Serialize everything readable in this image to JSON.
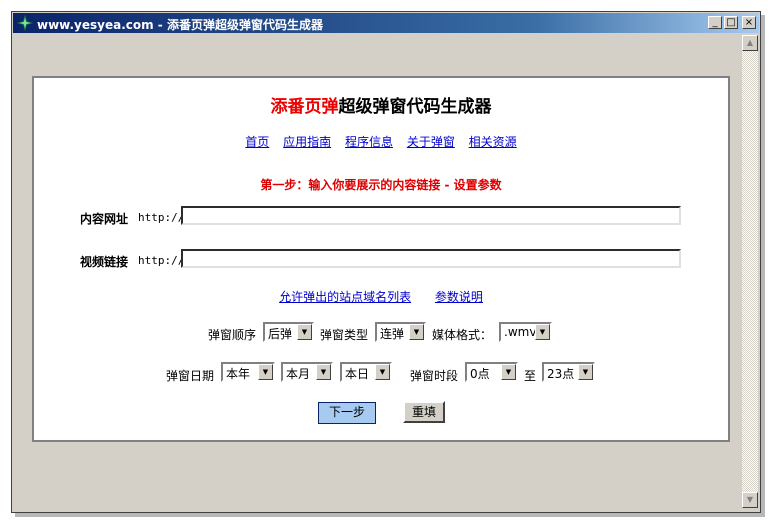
{
  "window": {
    "title": "www.yesyea.com - 添番页弹超级弹窗代码生成器"
  },
  "heading": {
    "red_part": "添番页弹",
    "black_part": "超级弹窗代码生成器"
  },
  "nav": [
    "首页",
    "应用指南",
    "程序信息",
    "关于弹窗",
    "相关资源"
  ],
  "step_text": "第一步：输入你要展示的内容链接 - 设置参数",
  "content_url": {
    "label": "内容网址",
    "prefix": "http://",
    "value": ""
  },
  "video_link": {
    "label": "视频链接",
    "prefix": "http://",
    "value": ""
  },
  "links": [
    "允许弹出的站点域名列表",
    "参数说明"
  ],
  "popup_order": {
    "label": "弹窗顺序",
    "value": "后弹"
  },
  "popup_type": {
    "label": "弹窗类型",
    "value": "连弹"
  },
  "media_format": {
    "label": "媒体格式：",
    "value": ".wmv"
  },
  "popup_date": {
    "label": "弹窗日期",
    "year": "本年",
    "month": "本月",
    "day": "本日"
  },
  "popup_time": {
    "label": "弹窗时段",
    "from": "0点",
    "to_label": "至",
    "to": "23点"
  },
  "buttons": {
    "next": "下一步",
    "reset": "重填"
  },
  "colors": {
    "title_bar": "#0a246a",
    "heading_red": "#ee0000",
    "link_blue": "#0000cc",
    "step_red": "#dd0000"
  }
}
